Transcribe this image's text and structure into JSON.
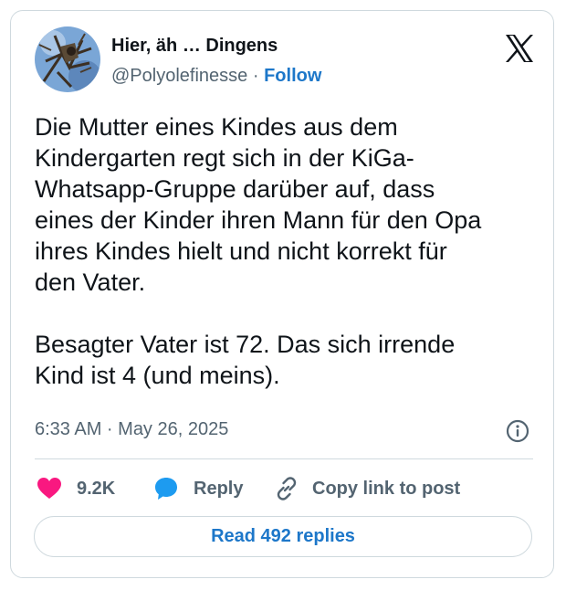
{
  "author": {
    "display_name": "Hier, äh … Dingens",
    "handle": "@Polyolefinesse",
    "separator": "·",
    "follow_label": "Follow"
  },
  "tweet": {
    "text": "Die Mutter eines Kindes aus dem\nKindergarten regt sich in der KiGa-\nWhatsapp-Gruppe darüber auf, dass\neines der Kinder ihren Mann für den Opa\nihres Kindes hielt und nicht korrekt für\nden Vater.\n\nBesagter Vater ist 72. Das sich irrende\nKind ist 4 (und meins).",
    "timestamp": "6:33 AM · May 26, 2025"
  },
  "actions": {
    "like_count": "9.2K",
    "reply_label": "Reply",
    "copy_label": "Copy link to post"
  },
  "read_replies_label": "Read 492 replies",
  "colors": {
    "accent": "#1d77c9",
    "like": "#f91880",
    "reply": "#1d9bf0",
    "muted": "#536471",
    "border": "#cfd9de"
  },
  "icons": [
    "x-logo-icon",
    "info-icon",
    "heart-icon",
    "reply-bubble-icon",
    "link-icon"
  ]
}
